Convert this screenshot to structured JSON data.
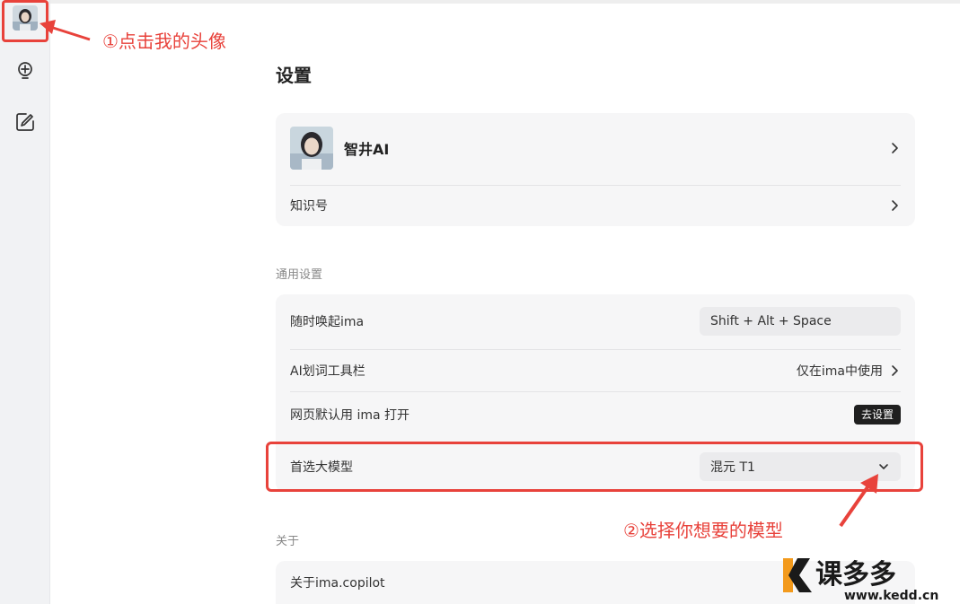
{
  "sidebar": {
    "items": [
      {
        "name": "avatar"
      },
      {
        "icon": "lightbulb-icon"
      },
      {
        "icon": "edit-icon"
      }
    ]
  },
  "settings": {
    "title": "设置",
    "profile": {
      "name": "智井AI",
      "knowledge_label": "知识号"
    },
    "general": {
      "section_label": "通用设置",
      "wake_label": "随时唤起ima",
      "wake_shortcut": "Shift + Alt + Space",
      "ai_toolbar_label": "AI划词工具栏",
      "ai_toolbar_value": "仅在ima中使用",
      "default_open_label": "网页默认用 ima 打开",
      "default_open_button": "去设置",
      "model_label": "首选大模型",
      "model_value": "混元 T1"
    },
    "about": {
      "section_label": "关于",
      "about_label": "关于ima.copilot"
    }
  },
  "annotations": {
    "step1": "①点击我的头像",
    "step2": "②选择你想要的模型",
    "color": "#e8423b"
  },
  "watermark": {
    "brand": "课多多",
    "url": "www.kedd.cn"
  }
}
